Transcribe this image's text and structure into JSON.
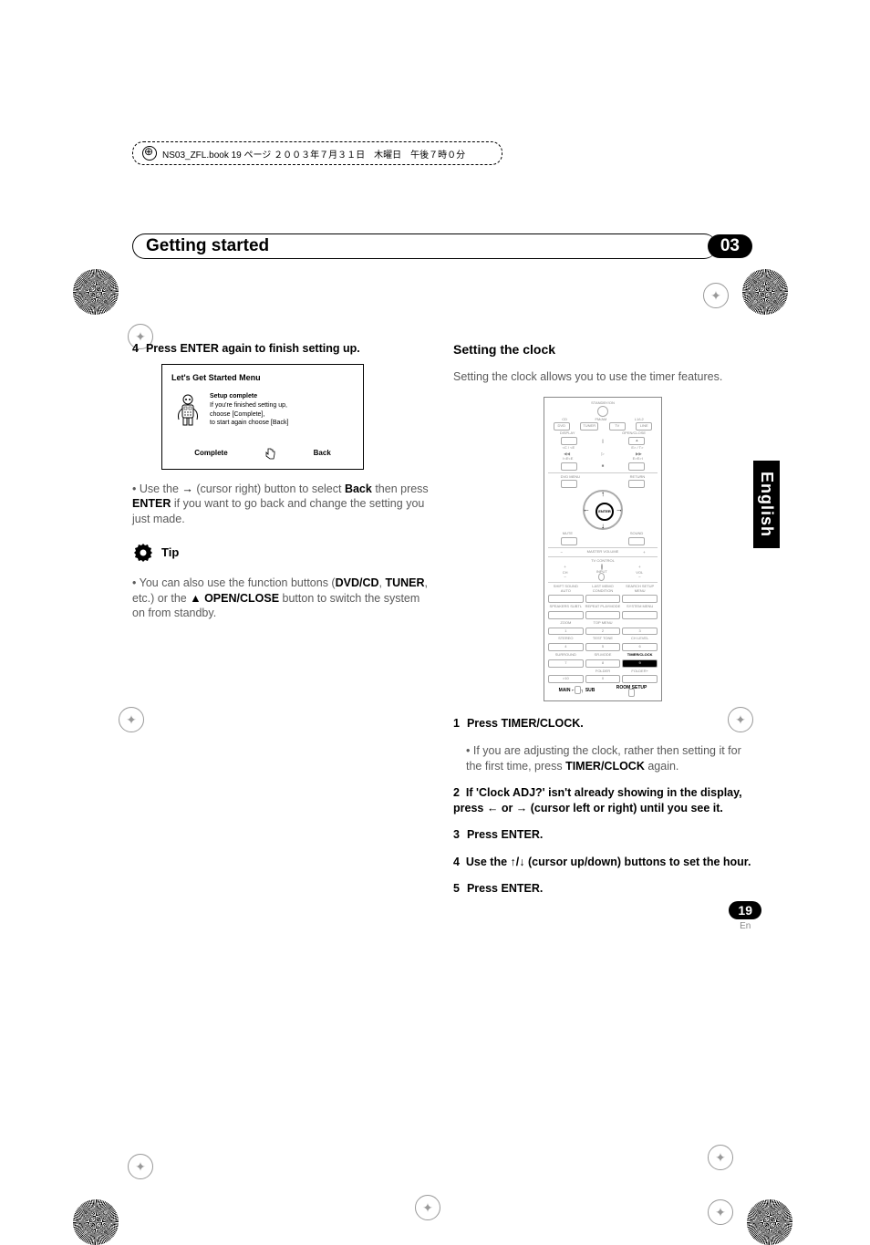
{
  "meta": "NS03_ZFL.book 19 ページ ２００３年７月３１日　木曜日　午後７時０分",
  "chapter": {
    "title": "Getting started",
    "num": "03"
  },
  "lang_tab": "English",
  "left": {
    "step4_num": "4",
    "step4_text": "Press ENTER again to finish setting up.",
    "screenshot": {
      "title": "Let's Get Started Menu",
      "head": "Setup complete",
      "line1": "If you're finished setting up,",
      "line2": "choose [Complete],",
      "line3": "to start again choose [Back]",
      "btn_complete": "Complete",
      "btn_back": "Back"
    },
    "bullet1_pre": "• Use the ",
    "bullet1_mid1": " (cursor right) button to select ",
    "bullet1_back": "Back",
    "bullet1_mid2": " then press ",
    "bullet1_enter": "ENTER",
    "bullet1_post": " if you want to go back and change the setting you just made.",
    "tip_label": "Tip",
    "tip_text_pre": "• You can also use the function buttons (",
    "tip_dvdcd": "DVD/CD",
    "tip_comma": ", ",
    "tip_tuner": "TUNER",
    "tip_etc": ", etc.) or the ",
    "tip_open": " OPEN/CLOSE",
    "tip_post": " button to switch the system on from standby."
  },
  "right": {
    "heading": "Setting the clock",
    "intro": "Setting the clock allows you to use the timer features.",
    "remote": {
      "standby": "STANDBY/ON",
      "cd": "CD",
      "fm": "FM/AM",
      "l12": "L1/L2",
      "dvd": "DVD",
      "tuner": "TUNER",
      "tv": "TV",
      "line": "LINE",
      "display": "DISPLAY",
      "open": "OPEN/CLOSE",
      "prev_gt": "<C / <E",
      "next_gt": "E> / T>",
      "pause_l": "I<E<E",
      "pause_r": "E>E>I",
      "dvdmenu": "DVD MENU",
      "return": "RETURN",
      "enter": "ENTER",
      "mute": "MUTE",
      "sound": "SOUND",
      "master": "MASTER VOLUME",
      "tvctrl": "TV CONTROL",
      "ch": "CH",
      "input": "INPUT",
      "vol": "VOL",
      "shift": "SHIFT SOUND AUTO",
      "lastmem": "LAST MEMO CONDITION",
      "search": "SEARCH SETUP MENU",
      "speaker": "SPEAKERS SUBTL",
      "repeat": "REPEAT PLAYMODE",
      "system": "SYSTEM MENU",
      "zoom": "ZOOM",
      "top": "TOP MENU",
      "n1": "1",
      "n2": "2",
      "n3": "3",
      "n4": "4",
      "n5": "5",
      "n6": "6",
      "n7": "7",
      "n8": "8",
      "n9": "9",
      "n0": "0",
      "n10": ">10",
      "stereo": "STEREO",
      "testtone": "TEST TONE",
      "chlevel": "CH LEVEL",
      "surround": "SURROUND",
      "srmode": "SR-MODE",
      "timer": "TIMER/CLOCK",
      "folder_m": "FOLDER",
      "folder_p": "FOLDER+",
      "main": "MAIN",
      "sub": "SUB",
      "roomsetup": "ROOM SETUP"
    },
    "s1_num": "1",
    "s1_text": "Press TIMER/CLOCK.",
    "s1_bullet_pre": "• If you are adjusting the clock, rather then setting it for the first time, press ",
    "s1_bullet_bold": "TIMER/CLOCK",
    "s1_bullet_post": " again.",
    "s2_num": "2",
    "s2_pre": "If 'Clock ADJ?' isn't already showing in the display, press ",
    "s2_mid": " or ",
    "s2_post": " (cursor left or right) until you see it.",
    "s3_num": "3",
    "s3_text": "Press ENTER.",
    "s4_num": "4",
    "s4_pre": "Use the ",
    "s4_post": " (cursor up/down) buttons to set the hour.",
    "s5_num": "5",
    "s5_text": "Press ENTER."
  },
  "page": {
    "num": "19",
    "lang": "En"
  }
}
